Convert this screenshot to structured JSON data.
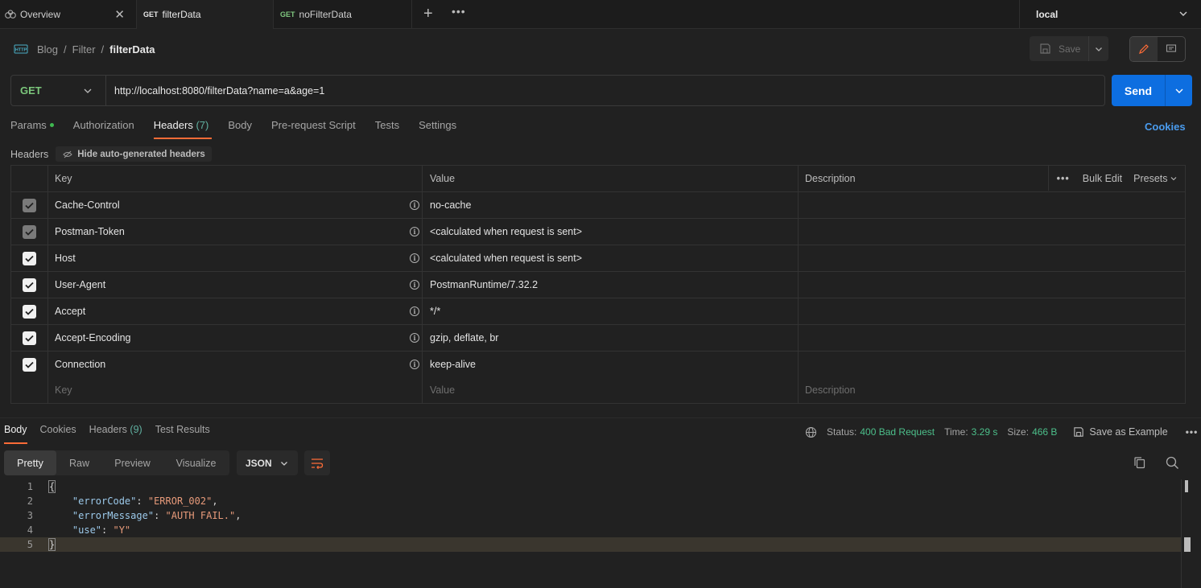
{
  "tabs": {
    "overview": "Overview",
    "items": [
      {
        "method": "GET",
        "name": "filterData"
      },
      {
        "method": "GET",
        "name": "noFilterData"
      }
    ],
    "environment": "local"
  },
  "breadcrumb": {
    "items": [
      "Blog",
      "Filter"
    ],
    "current": "filterData",
    "separator": "/"
  },
  "toolbar": {
    "save_label": "Save"
  },
  "request": {
    "method": "GET",
    "url": "http://localhost:8080/filterData?name=a&age=1",
    "send_label": "Send"
  },
  "request_tabs": {
    "params": "Params",
    "authorization": "Authorization",
    "headers": "Headers",
    "headers_count": "(7)",
    "body": "Body",
    "prerequest": "Pre-request Script",
    "tests": "Tests",
    "settings": "Settings",
    "cookies": "Cookies"
  },
  "headers_section": {
    "title": "Headers",
    "hide_auto": "Hide auto-generated headers",
    "columns": {
      "key": "Key",
      "value": "Value",
      "description": "Description"
    },
    "bulk_edit": "Bulk Edit",
    "presets": "Presets",
    "rows": [
      {
        "key": "Cache-Control",
        "value": "no-cache",
        "locked": true
      },
      {
        "key": "Postman-Token",
        "value": "<calculated when request is sent>",
        "locked": true
      },
      {
        "key": "Host",
        "value": "<calculated when request is sent>",
        "locked": false
      },
      {
        "key": "User-Agent",
        "value": "PostmanRuntime/7.32.2",
        "locked": false
      },
      {
        "key": "Accept",
        "value": "*/*",
        "locked": false
      },
      {
        "key": "Accept-Encoding",
        "value": "gzip, deflate, br",
        "locked": false
      },
      {
        "key": "Connection",
        "value": "keep-alive",
        "locked": false
      }
    ],
    "placeholder": {
      "key": "Key",
      "value": "Value",
      "description": "Description"
    }
  },
  "response": {
    "tabs": {
      "body": "Body",
      "cookies": "Cookies",
      "headers": "Headers",
      "headers_count": "(9)",
      "tests": "Test Results"
    },
    "status_label": "Status:",
    "status_value": "400 Bad Request",
    "time_label": "Time:",
    "time_value": "3.29 s",
    "size_label": "Size:",
    "size_value": "466 B",
    "save_example": "Save as Example",
    "views": [
      "Pretty",
      "Raw",
      "Preview",
      "Visualize"
    ],
    "format": "JSON",
    "body_lines": [
      {
        "n": "1",
        "open": "{"
      },
      {
        "n": "2",
        "key": "\"errorCode\"",
        "val": "\"ERROR_002\"",
        "tail": ","
      },
      {
        "n": "3",
        "key": "\"errorMessage\"",
        "val": "\"AUTH FAIL.\"",
        "tail": ","
      },
      {
        "n": "4",
        "key": "\"use\"",
        "val": "\"Y\"",
        "tail": ""
      },
      {
        "n": "5",
        "open": "}"
      }
    ]
  },
  "colors": {
    "accent": "#ff6c37",
    "send": "#0d6ee0",
    "status_ok": "#4cbf8a",
    "method_get": "#7bc67b"
  }
}
